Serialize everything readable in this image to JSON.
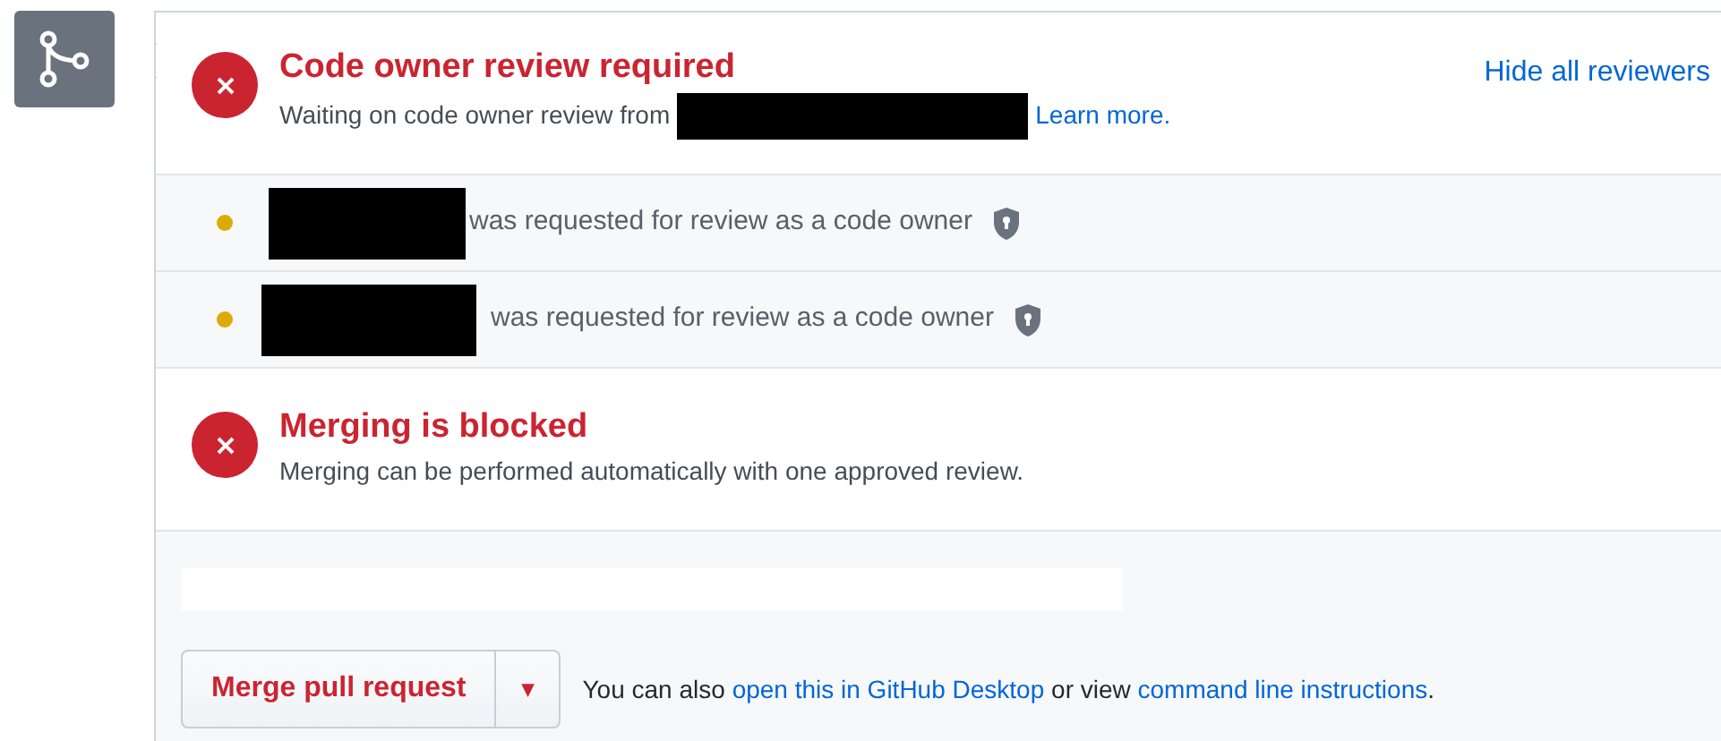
{
  "review_status": {
    "title": "Code owner review required",
    "description": "Waiting on code owner review from",
    "description_redacted": true,
    "learn_more_link": "Learn more.",
    "toggle_link": "Hide all reviewers"
  },
  "reviewers": [
    {
      "name_redacted": true,
      "text": "was requested for review as a code owner",
      "color": "#dbab09"
    },
    {
      "name_redacted": true,
      "text": "was requested for review as a code owner",
      "color": "#dbab09"
    }
  ],
  "merge_status": {
    "title": "Merging is blocked",
    "description": "Merging can be performed automatically with one approved review."
  },
  "merge_actions": {
    "button": "Merge pull request",
    "dropdown": "▾",
    "hint_prefix": "You can also",
    "desktop_link": "open this in GitHub Desktop",
    "hint_middle": "or view",
    "cli_link": "command line instructions",
    "hint_suffix": "."
  }
}
